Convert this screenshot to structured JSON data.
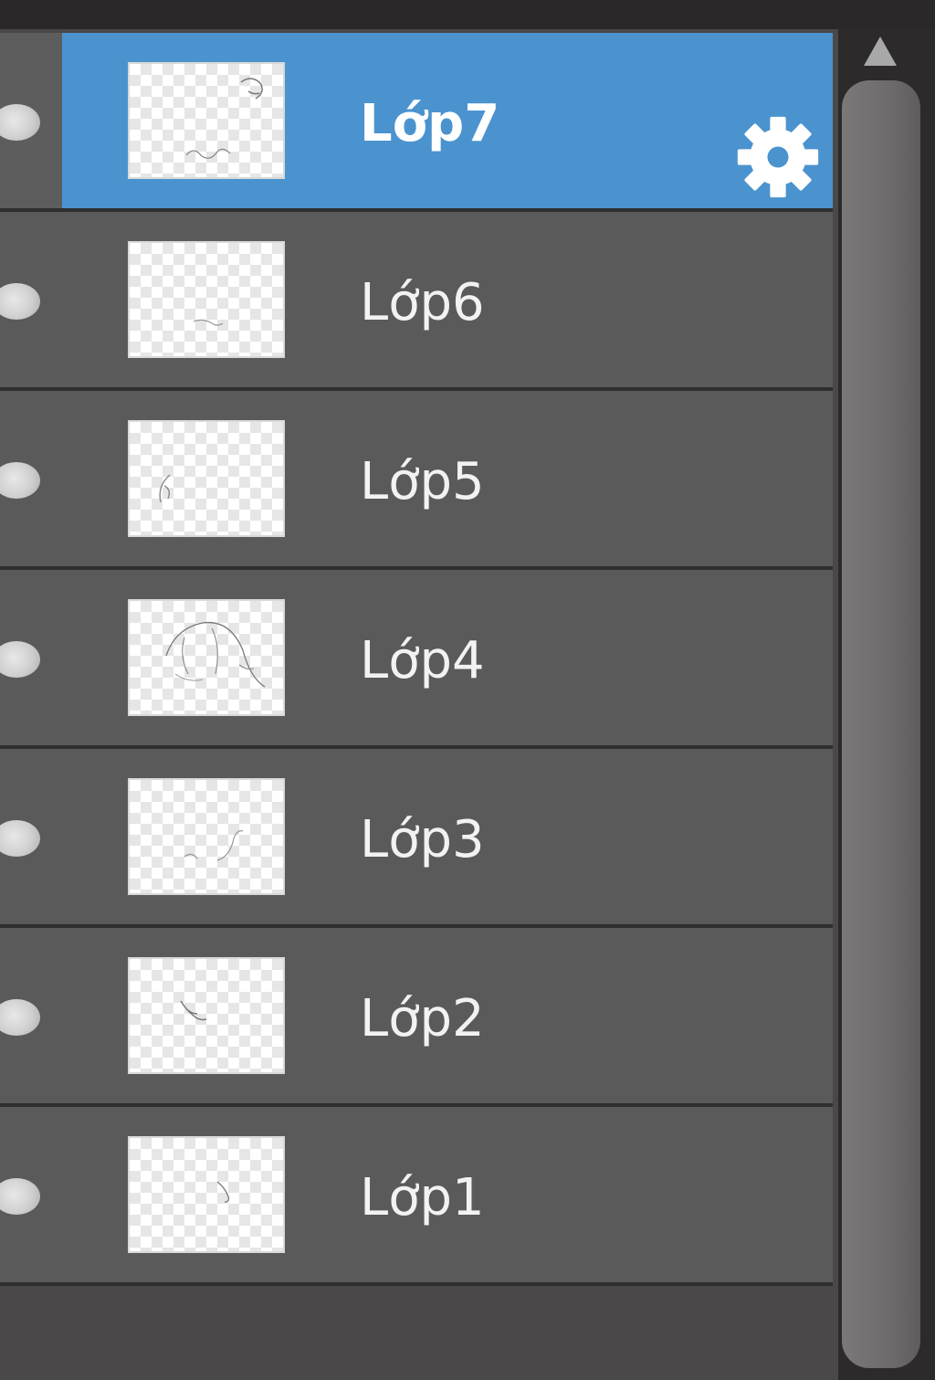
{
  "layers": [
    {
      "label": "Lớp7",
      "selected": true
    },
    {
      "label": "Lớp6",
      "selected": false
    },
    {
      "label": "Lớp5",
      "selected": false
    },
    {
      "label": "Lớp4",
      "selected": false
    },
    {
      "label": "Lớp3",
      "selected": false
    },
    {
      "label": "Lớp2",
      "selected": false
    },
    {
      "label": "Lớp1",
      "selected": false
    }
  ],
  "icons": {
    "visibility": "visibility-dot-icon",
    "settings": "gear-icon",
    "scroll_up": "triangle-up-icon"
  },
  "colors": {
    "selected_row": "#4b93cf",
    "row": "#5b5a5a",
    "panel": "#4a4849"
  }
}
